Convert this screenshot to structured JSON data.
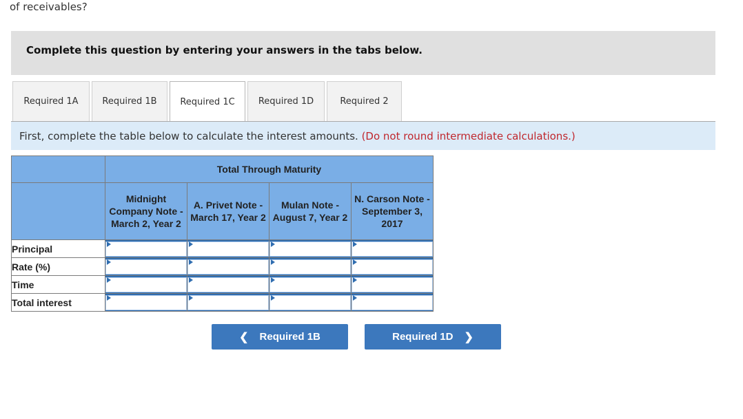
{
  "question_tail": "of receivables?",
  "instructions": "Complete this question by entering your answers in the tabs below.",
  "tabs": [
    {
      "label": "Required 1A",
      "active": false
    },
    {
      "label": "Required 1B",
      "active": false
    },
    {
      "label": "Required 1C",
      "active": true
    },
    {
      "label": "Required 1D",
      "active": false
    },
    {
      "label": "Required 2",
      "active": false
    }
  ],
  "prompt": {
    "text": "First, complete the table below to calculate the interest amounts.",
    "note": "(Do not round intermediate calculations.)"
  },
  "table": {
    "group_header": "Total Through Maturity",
    "columns": [
      "Midnight Company Note - March 2, Year 2",
      "A. Privet Note - March 17, Year 2",
      "Mulan Note - August 7, Year 2",
      "N. Carson Note - September 3, 2017"
    ],
    "rows": [
      {
        "label": "Principal",
        "values": [
          "",
          "",
          "",
          ""
        ]
      },
      {
        "label": "Rate (%)",
        "values": [
          "",
          "",
          "",
          ""
        ]
      },
      {
        "label": "Time",
        "values": [
          "",
          "",
          "",
          ""
        ]
      },
      {
        "label": "Total interest",
        "values": [
          "",
          "",
          "",
          ""
        ]
      }
    ]
  },
  "navigation": {
    "prev_label": "Required 1B",
    "next_label": "Required 1D",
    "prev_icon": "chevron-left-icon",
    "next_icon": "chevron-right-icon"
  },
  "colors": {
    "header_blue": "#7aaee6",
    "button_blue": "#3c78bd",
    "note_red": "#c0272d",
    "prompt_bg": "#dcebf8"
  }
}
